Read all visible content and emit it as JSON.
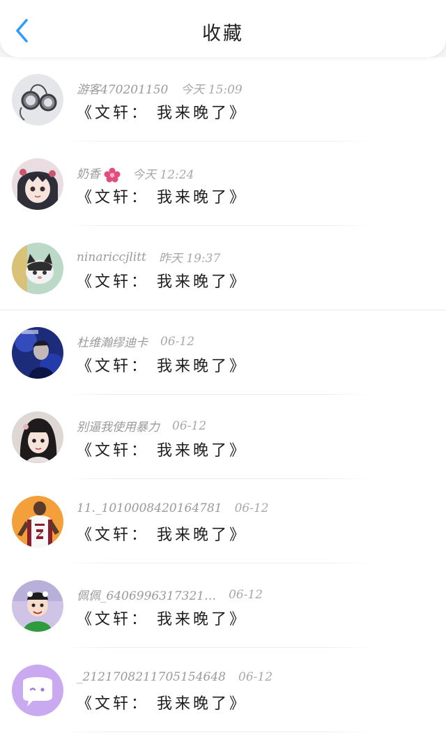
{
  "header": {
    "title": "收藏",
    "back_icon": "chevron-left-icon",
    "accent": "#2f9bff"
  },
  "items": [
    {
      "name": "游客470201150",
      "time": "今天 15:09",
      "content": "《文轩： 我来晚了》",
      "avatar": "pocket-watch-avatar"
    },
    {
      "name": "奶香",
      "time": "今天 12:24",
      "content": "《文轩： 我来晚了》",
      "avatar": "anime-girl-avatar",
      "badge": "flower-icon"
    },
    {
      "name": "ninariccjlitt",
      "time": "昨天 19:37",
      "content": "《文轩： 我来晚了》",
      "avatar": "cat-avatar"
    },
    {
      "name": "杜维瀚缪迪卡",
      "time": "06-12",
      "content": "《文轩： 我来晚了》",
      "avatar": "singer-avatar"
    },
    {
      "name": "别逼我使用暴力",
      "time": "06-12",
      "content": "《文轩： 我来晚了》",
      "avatar": "girl-selfie-avatar"
    },
    {
      "name": "11._1010008420164781",
      "time": "06-12",
      "content": "《文轩： 我来晚了》",
      "avatar": "basketball-player-avatar"
    },
    {
      "name": "佩佩_6406996317321…",
      "time": "06-12",
      "content": "《文轩： 我来晚了》",
      "avatar": "child-avatar"
    },
    {
      "name": "_2121708211705154648",
      "time": "06-12",
      "content": "《文轩： 我来晚了》",
      "avatar": "chat-bubble-avatar"
    }
  ]
}
